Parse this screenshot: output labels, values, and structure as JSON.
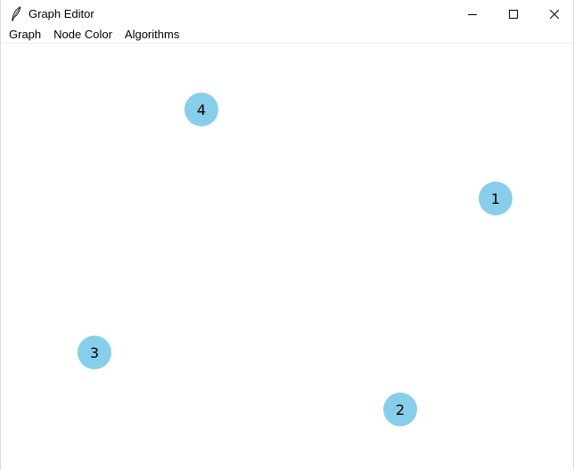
{
  "window": {
    "title": "Graph Editor",
    "icon": "feather-icon",
    "controls": [
      "minimize-icon",
      "maximize-icon",
      "close-icon"
    ]
  },
  "menubar": {
    "items": [
      {
        "label": "Graph"
      },
      {
        "label": "Node Color"
      },
      {
        "label": "Algorithms"
      }
    ]
  },
  "graph": {
    "node_color": "#87ceeb",
    "nodes": [
      {
        "label": "1"
      },
      {
        "label": "2"
      },
      {
        "label": "3"
      },
      {
        "label": "4"
      }
    ],
    "edges": []
  }
}
